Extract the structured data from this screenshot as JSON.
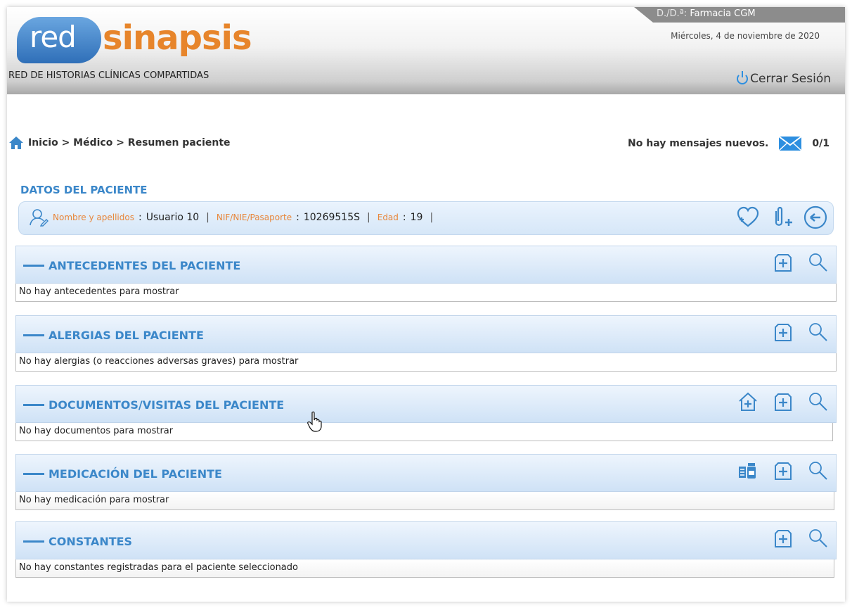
{
  "header": {
    "logo_part1": "red",
    "logo_part2": "sinapsis",
    "subtitle": "RED DE HISTORIAS CLÍNICAS COMPARTIDAS",
    "pharmacy_prefix": "D./D.ª:",
    "pharmacy_name": "Farmacia CGM",
    "date": "Miércoles, 4 de noviembre de 2020",
    "logout_label": "Cerrar Sesión"
  },
  "breadcrumb": {
    "text": "Inicio > Médico > Resumen paciente"
  },
  "messages": {
    "text": "No hay mensajes nuevos.",
    "count": "0/1"
  },
  "patient": {
    "section_title": "DATOS DEL PACIENTE",
    "name_label": "Nombre y apellidos",
    "name_value": "Usuario 10",
    "id_label": "NIF/NIE/Pasaporte",
    "id_value": "10269515S",
    "age_label": "Edad",
    "age_value": "19"
  },
  "panels": [
    {
      "title": "ANTECEDENTES DEL PACIENTE",
      "body": "No hay antecedentes para mostrar"
    },
    {
      "title": "ALERGIAS DEL PACIENTE",
      "body": "No hay alergias (o reacciones adversas graves) para mostrar"
    },
    {
      "title": "DOCUMENTOS/VISITAS DEL PACIENTE",
      "body": "No hay documentos para mostrar"
    },
    {
      "title": "MEDICACIÓN DEL PACIENTE",
      "body": "No hay medicación para mostrar"
    },
    {
      "title": "CONSTANTES",
      "body": "No hay constantes registradas para el paciente seleccionado"
    }
  ],
  "colors": {
    "accent_blue": "#3b87c9",
    "label_orange": "#e8863a",
    "logo_orange": "#e7852b"
  }
}
